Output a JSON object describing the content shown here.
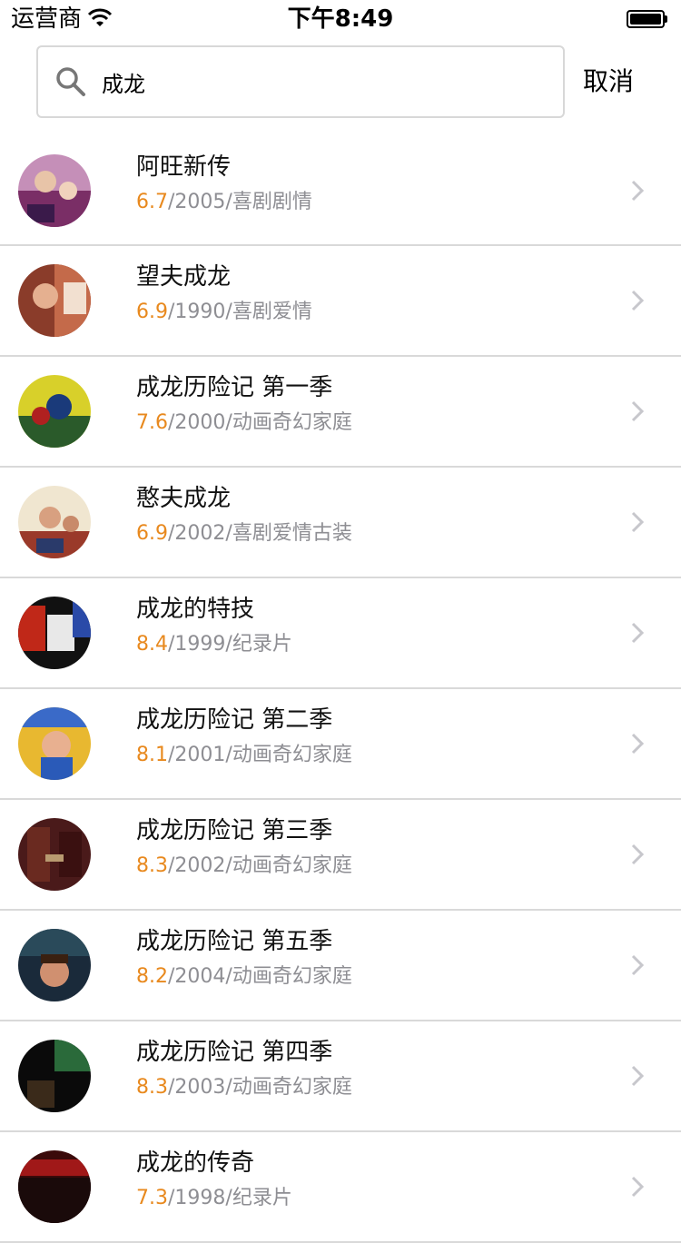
{
  "status_bar": {
    "carrier": "运营商",
    "time": "下午8:49"
  },
  "search": {
    "value": "成龙",
    "cancel_label": "取消"
  },
  "results": [
    {
      "title": "阿旺新传",
      "rating": "6.7",
      "year": "2005",
      "genres": "喜剧剧情"
    },
    {
      "title": "望夫成龙",
      "rating": "6.9",
      "year": "1990",
      "genres": "喜剧爱情"
    },
    {
      "title": "成龙历险记 第一季",
      "rating": "7.6",
      "year": "2000",
      "genres": "动画奇幻家庭"
    },
    {
      "title": "憨夫成龙",
      "rating": "6.9",
      "year": "2002",
      "genres": "喜剧爱情古装"
    },
    {
      "title": "成龙的特技",
      "rating": "8.4",
      "year": "1999",
      "genres": "纪录片"
    },
    {
      "title": "成龙历险记 第二季",
      "rating": "8.1",
      "year": "2001",
      "genres": "动画奇幻家庭"
    },
    {
      "title": "成龙历险记 第三季",
      "rating": "8.3",
      "year": "2002",
      "genres": "动画奇幻家庭"
    },
    {
      "title": "成龙历险记 第五季",
      "rating": "8.2",
      "year": "2004",
      "genres": "动画奇幻家庭"
    },
    {
      "title": "成龙历险记 第四季",
      "rating": "8.3",
      "year": "2003",
      "genres": "动画奇幻家庭"
    },
    {
      "title": "成龙的传奇",
      "rating": "7.3",
      "year": "1998",
      "genres": "纪录片"
    }
  ],
  "colors": {
    "rating": "#e8891e",
    "meta": "#8e8e93",
    "divider": "#d9d9d9"
  }
}
